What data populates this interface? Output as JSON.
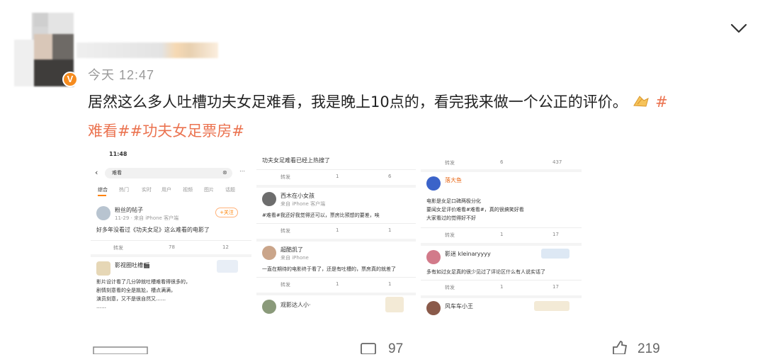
{
  "post": {
    "time": "今天 12:47",
    "text": "居然这么多人吐槽功夫女足难看，我是晚上10点的，看完我来做一个公正的评价。",
    "hashtag_start": "#",
    "hashtags_line2": "难看##功夫女足票房#"
  },
  "screenshots": {
    "s1": {
      "status_time": "11:48",
      "search_text": "难看",
      "tabs": [
        "综合",
        "热门",
        "实时",
        "用户",
        "视频",
        "图片",
        "话题"
      ],
      "c1_name": "粉丝的帖子",
      "c1_meta": "11-29 · 来自 iPhone 客户端",
      "c1_follow": "+关注",
      "c1_text": "好多年没看过《功夫女足》这么难看的电影了",
      "c1_repost": "转发",
      "c1_comment": "78",
      "c1_like": "12",
      "c2_name": "影视圈吐槽🎬",
      "c2_text1": "影片设计看了几分钟就吐槽难看得很多的，",
      "c2_text2": "剧情刻意看的全是尴尬，槽点满满，",
      "c2_text3": "演员刻意，又不是很自然又……",
      "c2_text4": "……"
    },
    "s2": {
      "top_text": "功夫女足难看已经上热搜了",
      "repost": "转发",
      "comment": "1",
      "like": "6",
      "c1_name": "西木在小女孩",
      "c1_meta": "来自 iPhone 客户端",
      "c1_text": "#难看#我还好我觉得还可以，票房比预想的要差，唉",
      "c1_repost": "转发",
      "c1_comment": "1",
      "c1_like": "1",
      "c2_name": "超酷凯了",
      "c2_meta": "来自 iPhone",
      "c2_text": "一直在期待的电影终于看了，还是有吐槽的，票房真的就差了",
      "c2_repost": "转发",
      "c2_comment": "1",
      "c2_like": "1",
      "c3_name": "观影达人小·"
    },
    "s3": {
      "repost": "转发",
      "comment": "6",
      "like": "437",
      "c1_name": "落大鱼",
      "c1_text1": "电影是女足口碑两极分化",
      "c1_text2": "要闻女足评价难看#难看#，真的很搞笑好看",
      "c1_text3": "大家看过的觉得好不好",
      "c1_repost": "转发",
      "c1_comment": "1",
      "c1_like": "17",
      "c2_name": "影迷 kleinaryyyy",
      "c2_text": "多有如过女足真的很少见过了评论区什么有人说实话了",
      "c2_repost": "转发",
      "c2_comment": "1",
      "c2_like": "17",
      "c3_name": "风车车小王"
    }
  },
  "bottom": {
    "comment_count": "97",
    "like_count": "219"
  },
  "colors": {
    "accent": "#eb7350",
    "badge": "#f58b1f",
    "muted_text": "#9a9a9a"
  }
}
